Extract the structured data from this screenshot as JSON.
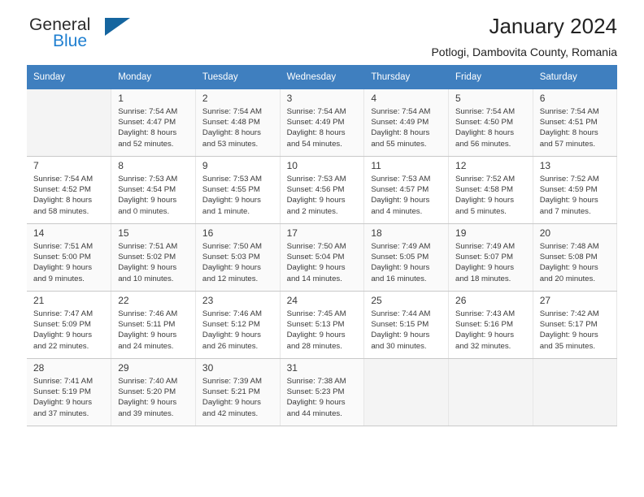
{
  "brand": {
    "name_top": "General",
    "name_bottom": "Blue",
    "accent_color": "#1f7fd0",
    "triangle_color": "#15659f",
    "triangle_icon": "brand-triangle-icon"
  },
  "header": {
    "title": "January 2024",
    "subtitle": "Potlogi, Dambovita County, Romania"
  },
  "calendar": {
    "header_bg": "#3f7fbf",
    "weekdays": [
      "Sunday",
      "Monday",
      "Tuesday",
      "Wednesday",
      "Thursday",
      "Friday",
      "Saturday"
    ],
    "weeks": [
      [
        {
          "empty": true
        },
        {
          "day": "1",
          "sunrise": "Sunrise: 7:54 AM",
          "sunset": "Sunset: 4:47 PM",
          "daylight1": "Daylight: 8 hours",
          "daylight2": "and 52 minutes."
        },
        {
          "day": "2",
          "sunrise": "Sunrise: 7:54 AM",
          "sunset": "Sunset: 4:48 PM",
          "daylight1": "Daylight: 8 hours",
          "daylight2": "and 53 minutes."
        },
        {
          "day": "3",
          "sunrise": "Sunrise: 7:54 AM",
          "sunset": "Sunset: 4:49 PM",
          "daylight1": "Daylight: 8 hours",
          "daylight2": "and 54 minutes."
        },
        {
          "day": "4",
          "sunrise": "Sunrise: 7:54 AM",
          "sunset": "Sunset: 4:49 PM",
          "daylight1": "Daylight: 8 hours",
          "daylight2": "and 55 minutes."
        },
        {
          "day": "5",
          "sunrise": "Sunrise: 7:54 AM",
          "sunset": "Sunset: 4:50 PM",
          "daylight1": "Daylight: 8 hours",
          "daylight2": "and 56 minutes."
        },
        {
          "day": "6",
          "sunrise": "Sunrise: 7:54 AM",
          "sunset": "Sunset: 4:51 PM",
          "daylight1": "Daylight: 8 hours",
          "daylight2": "and 57 minutes."
        }
      ],
      [
        {
          "day": "7",
          "sunrise": "Sunrise: 7:54 AM",
          "sunset": "Sunset: 4:52 PM",
          "daylight1": "Daylight: 8 hours",
          "daylight2": "and 58 minutes."
        },
        {
          "day": "8",
          "sunrise": "Sunrise: 7:53 AM",
          "sunset": "Sunset: 4:54 PM",
          "daylight1": "Daylight: 9 hours",
          "daylight2": "and 0 minutes."
        },
        {
          "day": "9",
          "sunrise": "Sunrise: 7:53 AM",
          "sunset": "Sunset: 4:55 PM",
          "daylight1": "Daylight: 9 hours",
          "daylight2": "and 1 minute."
        },
        {
          "day": "10",
          "sunrise": "Sunrise: 7:53 AM",
          "sunset": "Sunset: 4:56 PM",
          "daylight1": "Daylight: 9 hours",
          "daylight2": "and 2 minutes."
        },
        {
          "day": "11",
          "sunrise": "Sunrise: 7:53 AM",
          "sunset": "Sunset: 4:57 PM",
          "daylight1": "Daylight: 9 hours",
          "daylight2": "and 4 minutes."
        },
        {
          "day": "12",
          "sunrise": "Sunrise: 7:52 AM",
          "sunset": "Sunset: 4:58 PM",
          "daylight1": "Daylight: 9 hours",
          "daylight2": "and 5 minutes."
        },
        {
          "day": "13",
          "sunrise": "Sunrise: 7:52 AM",
          "sunset": "Sunset: 4:59 PM",
          "daylight1": "Daylight: 9 hours",
          "daylight2": "and 7 minutes."
        }
      ],
      [
        {
          "day": "14",
          "sunrise": "Sunrise: 7:51 AM",
          "sunset": "Sunset: 5:00 PM",
          "daylight1": "Daylight: 9 hours",
          "daylight2": "and 9 minutes."
        },
        {
          "day": "15",
          "sunrise": "Sunrise: 7:51 AM",
          "sunset": "Sunset: 5:02 PM",
          "daylight1": "Daylight: 9 hours",
          "daylight2": "and 10 minutes."
        },
        {
          "day": "16",
          "sunrise": "Sunrise: 7:50 AM",
          "sunset": "Sunset: 5:03 PM",
          "daylight1": "Daylight: 9 hours",
          "daylight2": "and 12 minutes."
        },
        {
          "day": "17",
          "sunrise": "Sunrise: 7:50 AM",
          "sunset": "Sunset: 5:04 PM",
          "daylight1": "Daylight: 9 hours",
          "daylight2": "and 14 minutes."
        },
        {
          "day": "18",
          "sunrise": "Sunrise: 7:49 AM",
          "sunset": "Sunset: 5:05 PM",
          "daylight1": "Daylight: 9 hours",
          "daylight2": "and 16 minutes."
        },
        {
          "day": "19",
          "sunrise": "Sunrise: 7:49 AM",
          "sunset": "Sunset: 5:07 PM",
          "daylight1": "Daylight: 9 hours",
          "daylight2": "and 18 minutes."
        },
        {
          "day": "20",
          "sunrise": "Sunrise: 7:48 AM",
          "sunset": "Sunset: 5:08 PM",
          "daylight1": "Daylight: 9 hours",
          "daylight2": "and 20 minutes."
        }
      ],
      [
        {
          "day": "21",
          "sunrise": "Sunrise: 7:47 AM",
          "sunset": "Sunset: 5:09 PM",
          "daylight1": "Daylight: 9 hours",
          "daylight2": "and 22 minutes."
        },
        {
          "day": "22",
          "sunrise": "Sunrise: 7:46 AM",
          "sunset": "Sunset: 5:11 PM",
          "daylight1": "Daylight: 9 hours",
          "daylight2": "and 24 minutes."
        },
        {
          "day": "23",
          "sunrise": "Sunrise: 7:46 AM",
          "sunset": "Sunset: 5:12 PM",
          "daylight1": "Daylight: 9 hours",
          "daylight2": "and 26 minutes."
        },
        {
          "day": "24",
          "sunrise": "Sunrise: 7:45 AM",
          "sunset": "Sunset: 5:13 PM",
          "daylight1": "Daylight: 9 hours",
          "daylight2": "and 28 minutes."
        },
        {
          "day": "25",
          "sunrise": "Sunrise: 7:44 AM",
          "sunset": "Sunset: 5:15 PM",
          "daylight1": "Daylight: 9 hours",
          "daylight2": "and 30 minutes."
        },
        {
          "day": "26",
          "sunrise": "Sunrise: 7:43 AM",
          "sunset": "Sunset: 5:16 PM",
          "daylight1": "Daylight: 9 hours",
          "daylight2": "and 32 minutes."
        },
        {
          "day": "27",
          "sunrise": "Sunrise: 7:42 AM",
          "sunset": "Sunset: 5:17 PM",
          "daylight1": "Daylight: 9 hours",
          "daylight2": "and 35 minutes."
        }
      ],
      [
        {
          "day": "28",
          "sunrise": "Sunrise: 7:41 AM",
          "sunset": "Sunset: 5:19 PM",
          "daylight1": "Daylight: 9 hours",
          "daylight2": "and 37 minutes."
        },
        {
          "day": "29",
          "sunrise": "Sunrise: 7:40 AM",
          "sunset": "Sunset: 5:20 PM",
          "daylight1": "Daylight: 9 hours",
          "daylight2": "and 39 minutes."
        },
        {
          "day": "30",
          "sunrise": "Sunrise: 7:39 AM",
          "sunset": "Sunset: 5:21 PM",
          "daylight1": "Daylight: 9 hours",
          "daylight2": "and 42 minutes."
        },
        {
          "day": "31",
          "sunrise": "Sunrise: 7:38 AM",
          "sunset": "Sunset: 5:23 PM",
          "daylight1": "Daylight: 9 hours",
          "daylight2": "and 44 minutes."
        },
        {
          "empty": true
        },
        {
          "empty": true
        },
        {
          "empty": true
        }
      ]
    ]
  }
}
